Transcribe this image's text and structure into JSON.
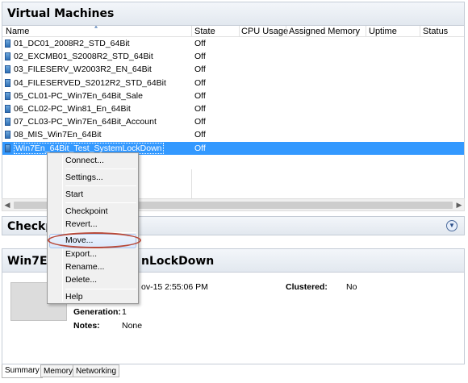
{
  "vm_pane": {
    "title": "Virtual Machines",
    "columns": [
      "Name",
      "State",
      "CPU Usage",
      "Assigned Memory",
      "Uptime",
      "Status"
    ],
    "rows": [
      {
        "name": "01_DC01_2008R2_STD_64Bit",
        "state": "Off"
      },
      {
        "name": "02_EXCMB01_S2008R2_STD_64Bit",
        "state": "Off"
      },
      {
        "name": "03_FILESERV_W2003R2_EN_64Bit",
        "state": "Off"
      },
      {
        "name": "04_FILESERVED_S2012R2_STD_64Bit",
        "state": "Off"
      },
      {
        "name": "05_CL01-PC_Win7En_64Bit_Sale",
        "state": "Off"
      },
      {
        "name": "06_CL02-PC_Win81_En_64Bit",
        "state": "Off"
      },
      {
        "name": "07_CL03-PC_Win7En_64Bit_Account",
        "state": "Off"
      },
      {
        "name": "08_MIS_Win7En_64Bit",
        "state": "Off"
      },
      {
        "name": "Win7En_64Bit_Test_SystemLockDown",
        "state": "Off"
      }
    ]
  },
  "checkpoints_pane": {
    "title": "Checkpo",
    "expand_icon": "chevron-down-circle-icon"
  },
  "detail_pane": {
    "title_left": "Win7En",
    "title_right": "nLockDown",
    "created_partial": "ov-15 2:55:06 PM",
    "clustered_label": "Clustered:",
    "clustered_value": "No",
    "generation_label": "Generation:",
    "generation_value": "1",
    "notes_label": "Notes:",
    "notes_value": "None"
  },
  "tabs": [
    "Summary",
    "Memory",
    "Networking"
  ],
  "context_menu": {
    "items": [
      "Connect...",
      "Settings...",
      "Start",
      "Checkpoint",
      "Revert...",
      "Move...",
      "Export...",
      "Rename...",
      "Delete...",
      "Help"
    ],
    "highlighted": "Move...",
    "annotation_color": "#b84a3a"
  },
  "colors": {
    "selection": "#3399ff",
    "header_bg": "#e2e8ef"
  }
}
